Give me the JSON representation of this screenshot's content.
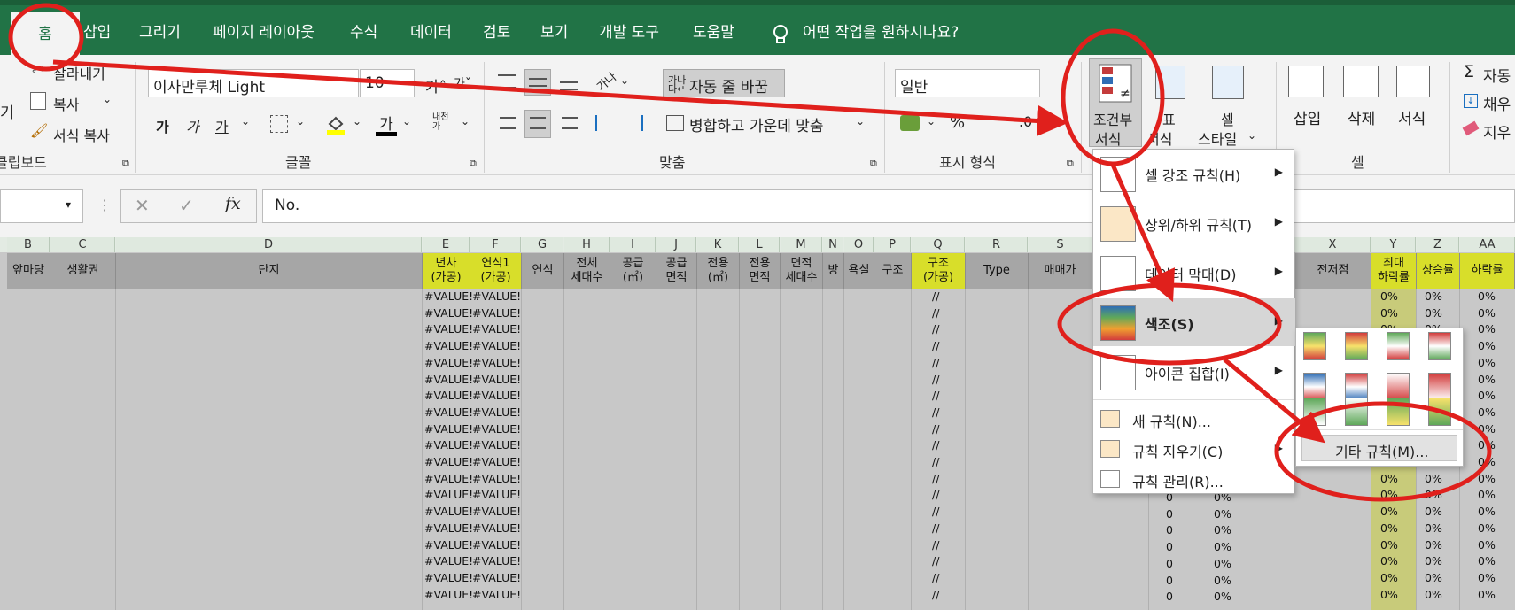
{
  "tabs": {
    "home": "홈",
    "insert": "삽입",
    "draw": "그리기",
    "layout": "페이지 레이아웃",
    "formulas": "수식",
    "data": "데이터",
    "review": "검토",
    "view": "보기",
    "developer": "개발 도구",
    "help": "도움말",
    "tellme": "어떤 작업을 원하시나요?"
  },
  "ribbon": {
    "cut": "잘라내기",
    "copy": "복사",
    "format_painter": "서식 복사",
    "clipboard": "클립보드",
    "clip_left": "기",
    "font_name": "이사만루체 Light",
    "font_size": "10",
    "bold": "가",
    "italic": "가",
    "underline": "가",
    "font_group": "글꼴",
    "wrap": "자동 줄 바꿈",
    "merge": "병합하고 가운데 맞춤",
    "align_group": "맞춤",
    "number_format": "일반",
    "percent": "%",
    "number_group": "표시 형식",
    "cond1": "조건부",
    "cond2": "서식",
    "table1": "표",
    "table2": "서식",
    "style1": "셀",
    "style2": "스타일",
    "insert": "삽입",
    "delete": "삭제",
    "format": "서식",
    "cells_group": "셀",
    "autosum": "자동",
    "fill": "채우",
    "clear": "지우"
  },
  "formula": {
    "fx": "fx",
    "content": "No."
  },
  "columns": {
    "letters": [
      "B",
      "C",
      "D",
      "E",
      "F",
      "G",
      "H",
      "I",
      "J",
      "K",
      "L",
      "M",
      "N",
      "O",
      "P",
      "Q",
      "R",
      "S",
      "X",
      "Y",
      "Z",
      "AA"
    ]
  },
  "headers": {
    "b": "앞마당",
    "c": "생활권",
    "d": "단지",
    "e": "년차\n(가공)",
    "f": "연식1\n(가공)",
    "g": "연식",
    "h": "전체\n세대수",
    "i": "공급\n(㎡)",
    "j": "공급\n면적",
    "k": "전용\n(㎡)",
    "l": "전용\n면적",
    "m": "면적\n세대수",
    "n": "방",
    "o": "욕실",
    "p": "구조",
    "q": "구조\n(가공)",
    "r": "Type",
    "s": "매매가",
    "w": "",
    "x": "전저점",
    "y": "최대\n하락률",
    "z": "상승률",
    "aa": "하락률"
  },
  "cells": {
    "value_err": "#VALUE!",
    "slash": "//",
    "zero": "0",
    "pct": "0%"
  },
  "menu": {
    "highlight": "셀 강조 규칙(H)",
    "topbottom": "상위/하위 규칙(T)",
    "databar": "데이터 막대(D)",
    "colorscale": "색조(S)",
    "iconset": "아이콘 집합(I)",
    "newrule": "새 규칙(N)...",
    "clearrules": "규칙 지우기(C)",
    "managerules": "규칙 관리(R)...",
    "more": "기타 규칙(M)..."
  },
  "colors": {
    "ribbon_green": "#217346",
    "annotation_red": "#e0201c",
    "header_yellow": "#d8de2a"
  }
}
